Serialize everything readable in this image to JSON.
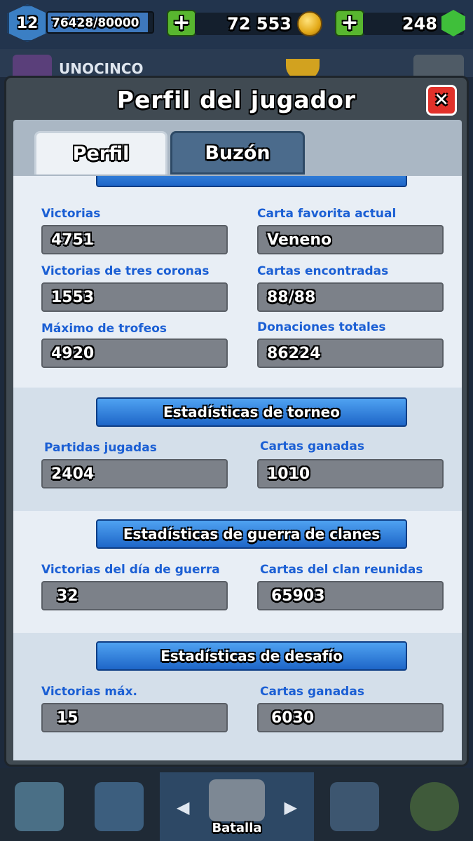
{
  "topbar": {
    "level": "12",
    "xp_text": "76428/80000",
    "xp_progress": 0.955,
    "plus_label": "+",
    "gold": "72 553",
    "gems": "248"
  },
  "peek": {
    "player_name": "UNOCINCO"
  },
  "modal": {
    "title": "Perfil del jugador",
    "close_label": "✕",
    "tabs": [
      {
        "label": "Perfil",
        "active": true
      },
      {
        "label": "Buzón",
        "active": false
      }
    ]
  },
  "stats": {
    "general": {
      "items": [
        {
          "label": "Victorias",
          "value": "4751"
        },
        {
          "label": "Carta favorita actual",
          "value": "Veneno"
        },
        {
          "label": "Victorias de tres coronas",
          "value": "1553"
        },
        {
          "label": "Cartas encontradas",
          "value": "88/88"
        },
        {
          "label": "Máximo de trofeos",
          "value": "4920"
        },
        {
          "label": "Donaciones totales",
          "value": "86224"
        }
      ]
    },
    "tournament": {
      "title": "Estadísticas de torneo",
      "items": [
        {
          "label": "Partidas jugadas",
          "value": "2404"
        },
        {
          "label": "Cartas ganadas",
          "value": "1010"
        }
      ]
    },
    "clan_war": {
      "title": "Estadísticas de guerra de clanes",
      "items": [
        {
          "label": "Victorias del día de guerra",
          "value": "32"
        },
        {
          "label": "Cartas del clan reunidas",
          "value": "65903"
        }
      ]
    },
    "challenge": {
      "title": "Estadísticas de desafío",
      "items": [
        {
          "label": "Victorias máx.",
          "value": "15"
        },
        {
          "label": "Cartas ganadas",
          "value": "6030"
        }
      ]
    }
  },
  "bottom_nav": {
    "battle_label": "Batalla",
    "left_arrow": "◀",
    "right_arrow": "▶"
  }
}
